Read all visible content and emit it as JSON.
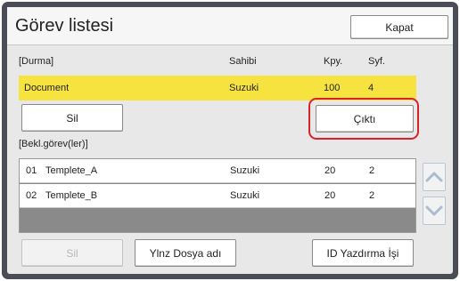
{
  "window": {
    "title": "Görev listesi",
    "close_label": "Kapat"
  },
  "columns": {
    "status_label": "[Durma]",
    "owner": "Sahibi",
    "copies": "Kpy.",
    "pages": "Syf."
  },
  "active_job": {
    "name": "Document",
    "owner": "Suzuki",
    "copies": "100",
    "pages": "4"
  },
  "actions": {
    "delete_label": "Sil",
    "output_label": "Çıktı"
  },
  "waiting": {
    "label": "[Bekl.görev(ler)]",
    "rows": [
      {
        "number": "01",
        "name": "Templete_A",
        "owner": "Suzuki",
        "copies": "20",
        "pages": "2"
      },
      {
        "number": "02",
        "name": "Templete_B",
        "owner": "Suzuki",
        "copies": "20",
        "pages": "2"
      }
    ]
  },
  "footer": {
    "delete_label": "Sil",
    "filename_only_label": "Ylnz Dosya adı",
    "id_print_label": "ID Yazdırma İşi"
  },
  "icons": {
    "scroll_up": "chevron-up-icon",
    "scroll_down": "chevron-down-icon"
  },
  "colors": {
    "active_row": "#f7e33f",
    "highlight": "#d9232b",
    "frame": "#4a4d55",
    "scroll_icon": "#a9bcd2"
  }
}
